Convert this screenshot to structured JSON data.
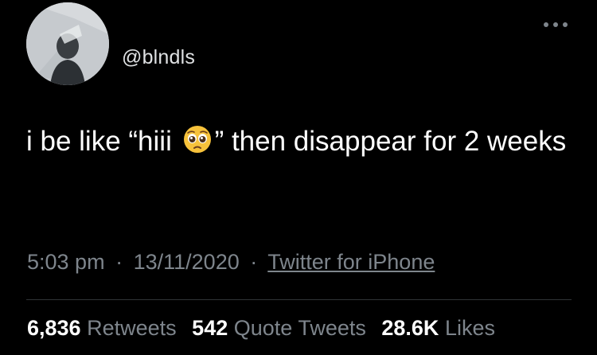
{
  "tweet": {
    "handle": "@blndls",
    "text_before_emoji": "i be like “hiii ",
    "emoji": "pleading-face-emoji",
    "text_after_emoji": "” then disappear for 2 weeks",
    "time": "5:03 pm",
    "date": "13/11/2020",
    "separator": "·",
    "source": "Twitter for iPhone"
  },
  "stats": {
    "retweets_count": "6,836",
    "retweets_label": "Retweets",
    "quote_count": "542",
    "quote_label": "Quote Tweets",
    "likes_count": "28.6K",
    "likes_label": "Likes"
  },
  "colors": {
    "background": "#000000",
    "text": "#ffffff",
    "muted": "#7e858c",
    "divider": "#2f3336"
  }
}
